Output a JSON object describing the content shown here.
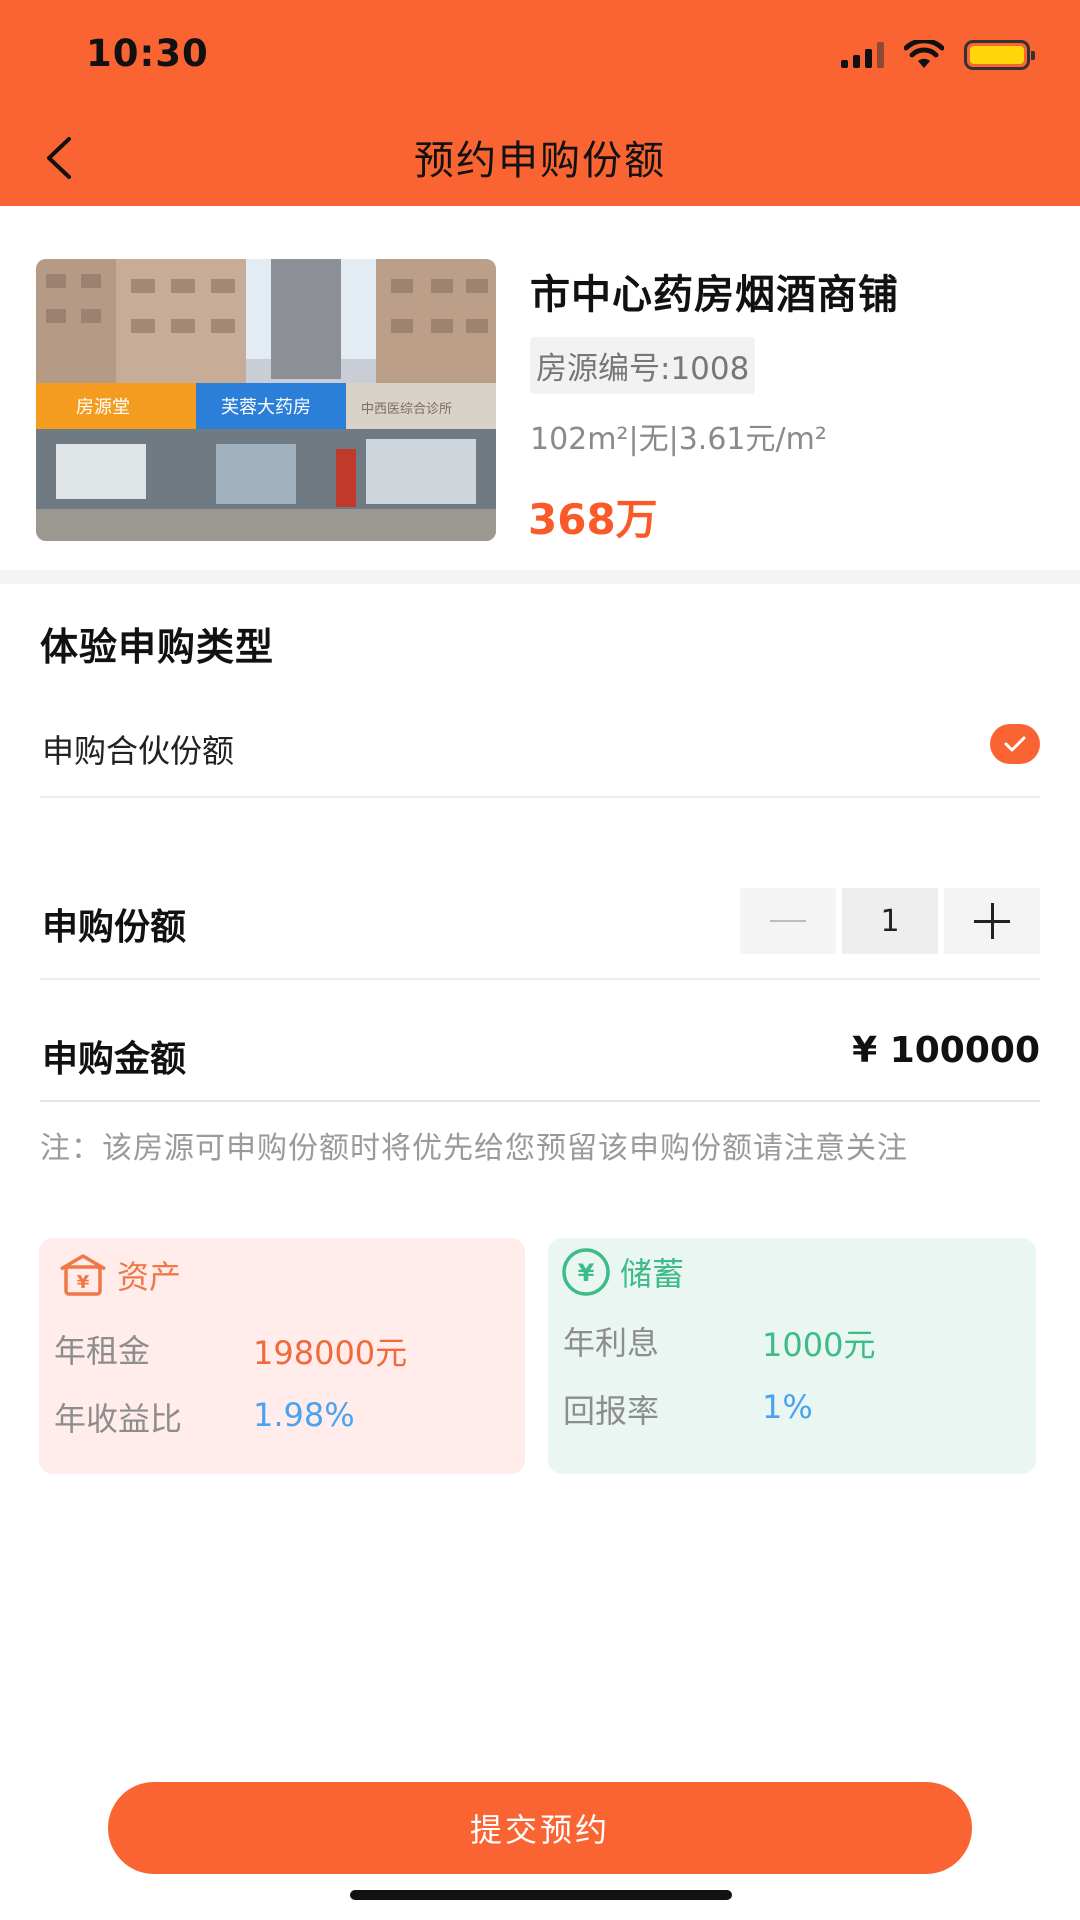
{
  "status_bar": {
    "time": "10:30"
  },
  "header": {
    "title": "预约申购份额",
    "back_icon": "chevron-left-icon"
  },
  "property": {
    "name": "市中心药房烟酒商铺",
    "code": "房源编号:1008",
    "spec": "102m²|无|3.61元/m²",
    "price": "368万",
    "photo_signs": [
      "房源堂",
      "芙蓉大药房",
      "中西医综合诊所"
    ]
  },
  "experience": {
    "title": "体验申购类型",
    "option_label": "申购合伙份额",
    "option_selected": true
  },
  "shares": {
    "label": "申购份额",
    "value": "1",
    "minus_symbol": "—",
    "plus_symbol": "+"
  },
  "amount": {
    "label": "申购金额",
    "value": "¥ 100000"
  },
  "note": "注：该房源可申购份额时将优先给您预留该申购份额请注意关注",
  "asset_card": {
    "icon": "yen-house-icon",
    "title": "资产",
    "rows": [
      {
        "label": "年租金",
        "value": "198000元"
      },
      {
        "label": "年收益比",
        "value": "1.98%"
      }
    ]
  },
  "savings_card": {
    "icon": "yen-circle-icon",
    "title": "储蓄",
    "rows": [
      {
        "label": "年利息",
        "value": "1000元"
      },
      {
        "label": "回报率",
        "value": "1%"
      }
    ]
  },
  "submit": {
    "label": "提交预约"
  },
  "colors": {
    "primary": "#fa6432",
    "asset_bg": "#ffeceb",
    "savings_bg": "#eaf6f1",
    "blue_value": "#4aa3f0",
    "green_value": "#3dbb88"
  }
}
